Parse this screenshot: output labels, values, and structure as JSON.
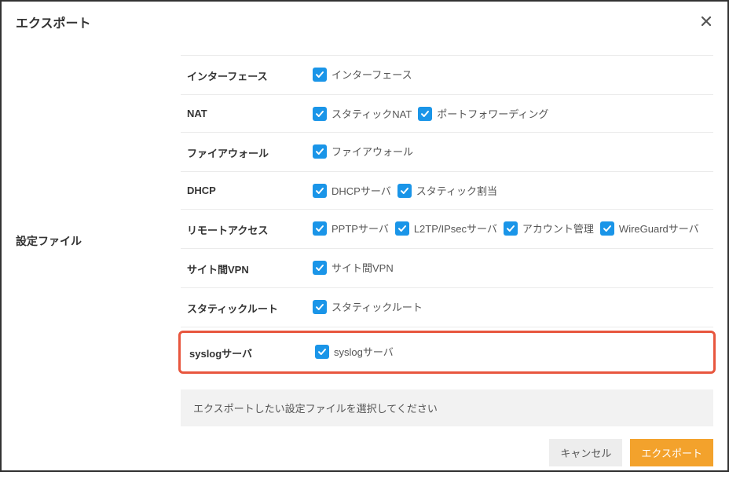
{
  "dialog": {
    "title": "エクスポート",
    "close_label": "閉じる"
  },
  "left_label": "設定ファイル",
  "rows": [
    {
      "label": "インターフェース",
      "options": [
        "インターフェース"
      ]
    },
    {
      "label": "NAT",
      "options": [
        "スタティックNAT",
        "ポートフォワーディング"
      ]
    },
    {
      "label": "ファイアウォール",
      "options": [
        "ファイアウォール"
      ]
    },
    {
      "label": "DHCP",
      "options": [
        "DHCPサーバ",
        "スタティック割当"
      ]
    },
    {
      "label": "リモートアクセス",
      "options": [
        "PPTPサーバ",
        "L2TP/IPsecサーバ",
        "アカウント管理",
        "WireGuardサーバ"
      ]
    },
    {
      "label": "サイト間VPN",
      "options": [
        "サイト間VPN"
      ]
    },
    {
      "label": "スタティックルート",
      "options": [
        "スタティックルート"
      ]
    },
    {
      "label": "syslogサーバ",
      "options": [
        "syslogサーバ"
      ],
      "highlight": true
    }
  ],
  "hint": "エクスポートしたい設定ファイルを選択してください",
  "footer": {
    "cancel": "キャンセル",
    "submit": "エクスポート"
  },
  "colors": {
    "checkbox": "#1a95e8",
    "highlight_border": "#e8563e",
    "primary_button": "#f3a22c"
  }
}
